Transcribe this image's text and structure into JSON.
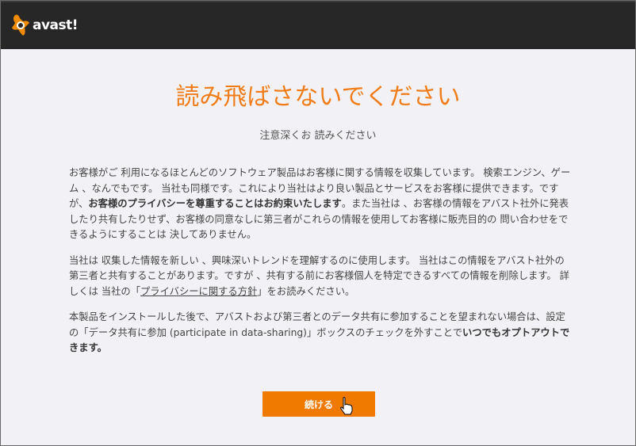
{
  "header": {
    "logo_text": "avast!"
  },
  "title": "読み飛ばさないでください",
  "subtitle": "注意深くお 読みください",
  "para1": {
    "t1": "お客様がご 利用になるほとんどのソフトウェア製品はお客様に関する情報を収集しています。 検索エンジン、ゲーム 、なんでもです。 当社も同様です。これにより当社はより良い製品とサービスをお客様に提供できます。ですが、",
    "b1": "お客様のプライバシーを尊重することはお約束いたします",
    "t2": "。また当社は 、お客様の情報をアバスト社外に発表したり共有したりせず、お客様の同意なしに第三者がこれらの情報を使用してお客様に販売目的の 問い合わせをできるようにすることは 決してありません。"
  },
  "para2": {
    "t1": "当社は 収集した情報を新しい 、興味深いトレンドを理解するのに使用します。 当社はこの情報をアバスト社外の第三者と共有することがあります。ですが 、共有する前にお客様個人を特定できるすべての情報を削除します。 詳しくは 当社の「",
    "link": "プライバシーに関する方針",
    "t2": "」をお読みください。"
  },
  "para3": {
    "t1": "本製品をインストールした後で、アバストおよび第三者とのデータ共有に参加することを望まれない場合は、設定の「データ共有に参加 (participate in data-sharing)」ボックスのチェックを外すことで",
    "b1": "いつでもオプトアウトできます。"
  },
  "continue_label": "続ける"
}
